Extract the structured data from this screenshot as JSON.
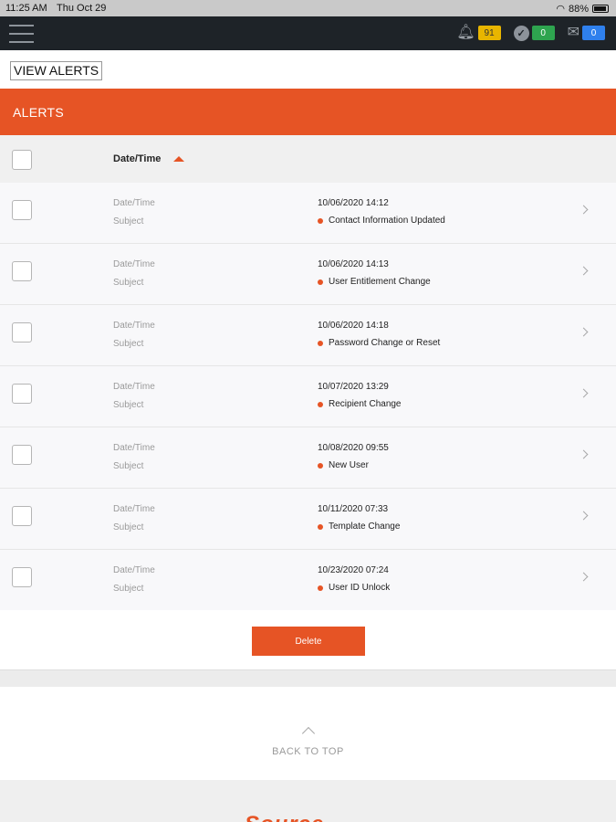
{
  "status_bar": {
    "time": "11:25 AM",
    "date": "Thu Oct 29",
    "battery": "88%"
  },
  "navbar": {
    "notifications_count": "91",
    "tasks_count": "0",
    "messages_count": "0",
    "notifications_badge_color": "#e8b500",
    "tasks_badge_color": "#2ea44f",
    "messages_badge_color": "#2f80ed"
  },
  "page": {
    "view_alerts_label": "VIEW ALERTS",
    "section_title": "ALERTS",
    "column_header": "Date/Time",
    "accent_color": "#e65425"
  },
  "alerts": [
    {
      "label_date": "Date/Time",
      "label_subject": "Subject",
      "date": "10/06/2020 14:12",
      "subject": "Contact Information Updated"
    },
    {
      "label_date": "Date/Time",
      "label_subject": "Subject",
      "date": "10/06/2020 14:13",
      "subject": "User Entitlement Change"
    },
    {
      "label_date": "Date/Time",
      "label_subject": "Subject",
      "date": "10/06/2020 14:18",
      "subject": "Password Change or Reset"
    },
    {
      "label_date": "Date/Time",
      "label_subject": "Subject",
      "date": "10/07/2020 13:29",
      "subject": "Recipient Change"
    },
    {
      "label_date": "Date/Time",
      "label_subject": "Subject",
      "date": "10/08/2020 09:55",
      "subject": "New User"
    },
    {
      "label_date": "Date/Time",
      "label_subject": "Subject",
      "date": "10/11/2020 07:33",
      "subject": "Template Change"
    },
    {
      "label_date": "Date/Time",
      "label_subject": "Subject",
      "date": "10/23/2020 07:24",
      "subject": "User ID Unlock"
    }
  ],
  "actions": {
    "delete_label": "Delete"
  },
  "footer": {
    "back_to_top": "BACK TO TOP",
    "logo_text": "Source"
  }
}
